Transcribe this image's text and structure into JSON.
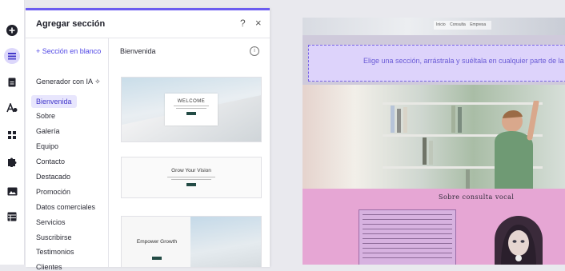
{
  "rail": {
    "icons": [
      "add-icon",
      "sections-icon",
      "page-icon",
      "text-style-icon",
      "apps-grid-icon",
      "puzzle-icon",
      "media-icon",
      "table-icon"
    ]
  },
  "panel": {
    "title": "Agregar sección",
    "help": "?",
    "close": "×",
    "blank_section": "+ Sección en blanco",
    "ai_generator": "Generador con IA",
    "categories": [
      "Bienvenida",
      "Sobre",
      "Galería",
      "Equipo",
      "Contacto",
      "Destacado",
      "Promoción",
      "Datos comerciales",
      "Servicios",
      "Suscribirse",
      "Testimonios",
      "Clientes"
    ],
    "active_category": "Bienvenida",
    "section_heading": "Bienvenida",
    "info": "i",
    "thumbs": [
      {
        "title": "WELCOME"
      },
      {
        "title": "Grow Your Vision"
      },
      {
        "title": "Empower Growth"
      }
    ]
  },
  "canvas": {
    "nav": [
      "Inicio",
      "Consulta",
      "Empresa"
    ],
    "drop_hint": "Elige una sección, arrástrala y suéltala en cualquier parte de la página",
    "about_title": "Sobre consulta vocal"
  },
  "colors": {
    "accent": "#6b5cf0",
    "active_bg": "#e8e6fd",
    "pink_section": "#e6a6d4"
  }
}
